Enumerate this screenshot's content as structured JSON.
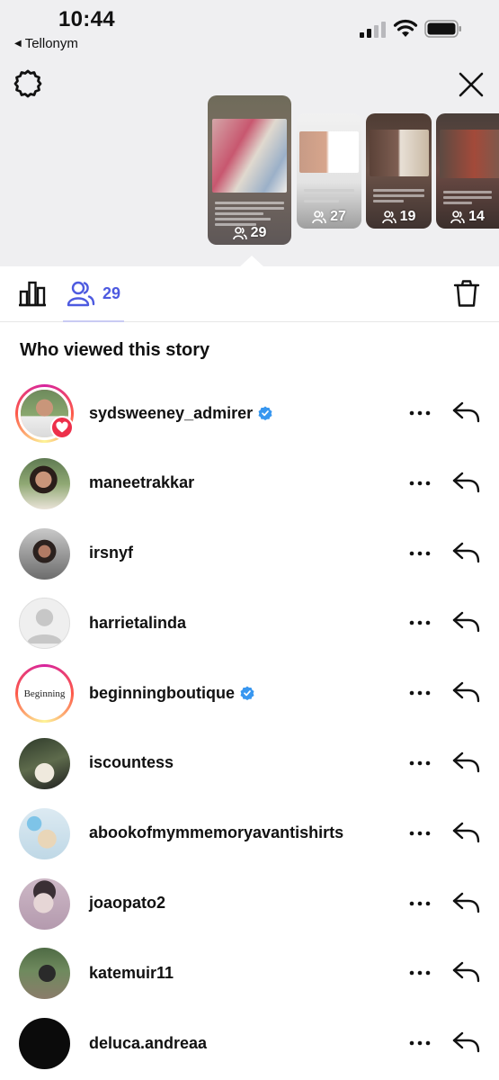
{
  "status_bar": {
    "time": "10:44",
    "back_app": "Tellonym",
    "back_icon": "back-triangle-icon"
  },
  "story_strip": {
    "settings_icon": "gear-icon",
    "close_icon": "close-icon",
    "stories": [
      {
        "views": "29",
        "selected": true
      },
      {
        "views": "27",
        "selected": false
      },
      {
        "views": "19",
        "selected": false
      },
      {
        "views": "14",
        "selected": false
      }
    ]
  },
  "tabs": {
    "stats_icon": "bar-chart-icon",
    "viewers_icon": "people-icon",
    "viewers_count": "29",
    "delete_icon": "trash-icon",
    "accent": "#4d5ae0"
  },
  "viewers": {
    "title": "Who viewed this story",
    "more_icon": "more-dots-icon",
    "reply_icon": "reply-arrow-icon",
    "items": [
      {
        "username": "sydsweeney_admirer",
        "verified": true,
        "story_ring": true,
        "liked": true
      },
      {
        "username": "maneetrakkar",
        "verified": false,
        "story_ring": false,
        "liked": false
      },
      {
        "username": "irsnyf",
        "verified": false,
        "story_ring": false,
        "liked": false
      },
      {
        "username": "harrietalinda",
        "verified": false,
        "story_ring": false,
        "liked": false
      },
      {
        "username": "beginningboutique",
        "verified": true,
        "story_ring": true,
        "liked": false,
        "avatar_text": "Beginning"
      },
      {
        "username": "iscountess",
        "verified": false,
        "story_ring": false,
        "liked": false
      },
      {
        "username": "abookofmymmemoryavantishirts",
        "verified": false,
        "story_ring": false,
        "liked": false
      },
      {
        "username": "joaopato2",
        "verified": false,
        "story_ring": false,
        "liked": false
      },
      {
        "username": "katemuir11",
        "verified": false,
        "story_ring": false,
        "liked": false
      },
      {
        "username": "deluca.andreaa",
        "verified": false,
        "story_ring": false,
        "liked": false
      }
    ]
  }
}
